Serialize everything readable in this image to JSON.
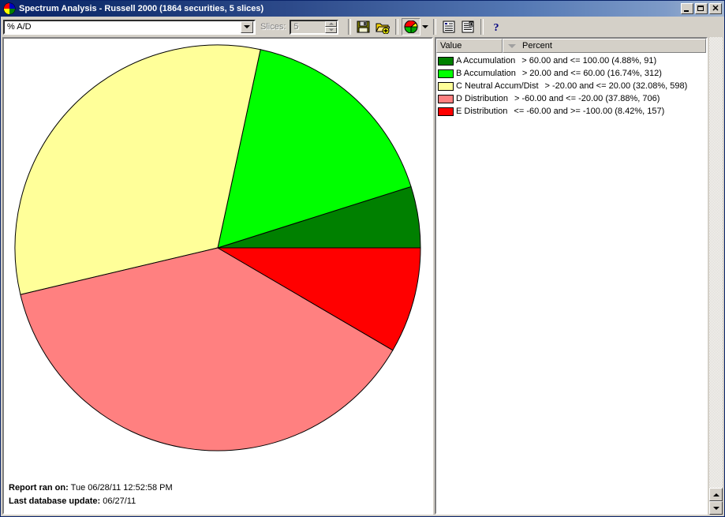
{
  "window": {
    "title": "Spectrum Analysis - Russell 2000 (1864 securities, 5 slices)",
    "app_icon": "pie-chart-icon",
    "minimize_label": "",
    "maximize_label": "",
    "close_label": "✕"
  },
  "toolbar": {
    "indicator_value": "% A/D",
    "slices_label": "Slices:",
    "slices_value": "5",
    "buttons": [
      {
        "name": "save-button",
        "icon": "floppy-disk-icon"
      },
      {
        "name": "open-add-button",
        "icon": "folder-add-icon"
      },
      {
        "name": "pie-chart-view-button",
        "icon": "pie-chart-icon"
      },
      {
        "name": "pie-chart-dropdown",
        "icon": "chevron-down-icon"
      },
      {
        "name": "list-view-button",
        "icon": "list-icon"
      },
      {
        "name": "report-view-button",
        "icon": "report-icon"
      },
      {
        "name": "help-button",
        "icon": "question-mark-icon"
      }
    ]
  },
  "legend": {
    "header": {
      "value_column": "Value",
      "percent_column": "Percent",
      "sort_indicator": "descending-sort-icon"
    },
    "rows": [
      {
        "color": "#008000",
        "label": "A Accumulation",
        "range": "> 60.00 and <= 100.00 (4.88%, 91)"
      },
      {
        "color": "#00ff00",
        "label": "B Accumulation",
        "range": "> 20.00 and <= 60.00 (16.74%, 312)"
      },
      {
        "color": "#ffff99",
        "label": "C Neutral Accum/Dist",
        "range": "> -20.00 and <= 20.00 (32.08%, 598)"
      },
      {
        "color": "#ff8080",
        "label": "D Distribution",
        "range": "> -60.00 and <= -20.00 (37.88%, 706)"
      },
      {
        "color": "#ff0000",
        "label": "E Distribution",
        "range": "<= -60.00 and >= -100.00 (8.42%, 157)"
      }
    ]
  },
  "footer": {
    "report_ran_label": "Report ran on:",
    "report_ran_value": "Tue 06/28/11 12:52:58 PM",
    "last_update_label": "Last database update:",
    "last_update_value": "06/27/11"
  },
  "chart_data": {
    "type": "pie",
    "title": "Spectrum Analysis - Russell 2000",
    "categories": [
      "A Accumulation",
      "B Accumulation",
      "C Neutral Accum/Dist",
      "D Distribution",
      "E Distribution"
    ],
    "values": [
      4.88,
      16.74,
      32.08,
      37.88,
      8.42
    ],
    "counts": [
      91,
      312,
      598,
      706,
      157
    ],
    "total_securities": 1864,
    "slice_count": 5,
    "colors": [
      "#008000",
      "#00ff00",
      "#ffff99",
      "#ff8080",
      "#ff0000"
    ],
    "ranges": [
      "> 60.00 and <= 100.00",
      "> 20.00 and <= 60.00",
      "> -20.00 and <= 20.00",
      "> -60.00 and <= -20.00",
      "<= -60.00 and >= -100.00"
    ],
    "start_angle_deg": 0,
    "direction": "counterclockwise",
    "legend_position": "right",
    "xlabel": "",
    "ylabel": ""
  }
}
